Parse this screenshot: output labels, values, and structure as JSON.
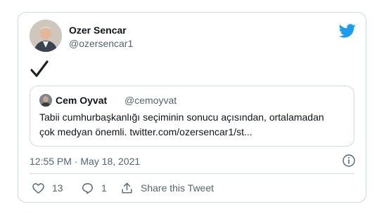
{
  "tweet": {
    "author": {
      "name": "Ozer Sencar",
      "handle": "@ozersencar1"
    },
    "body_icon": "check-mark-icon",
    "timestamp": "12:55 PM · May 18, 2021",
    "quoted": {
      "author_name": "Cem Oyvat",
      "author_handle": "@cemoyvat",
      "text_line1": "Tabii cumhurbaşkanlığı seçiminin sonucu açısından, ortalamadan",
      "text_line2": "çok medyan önemli. twitter.com/ozersencar1/st..."
    },
    "actions": {
      "likes": "13",
      "replies": "1",
      "share_label": "Share this Tweet"
    }
  },
  "colors": {
    "twitter_blue": "#1d9bf0",
    "secondary_text": "#536471",
    "border": "#cfd9de",
    "primary_text": "#0f1419"
  }
}
